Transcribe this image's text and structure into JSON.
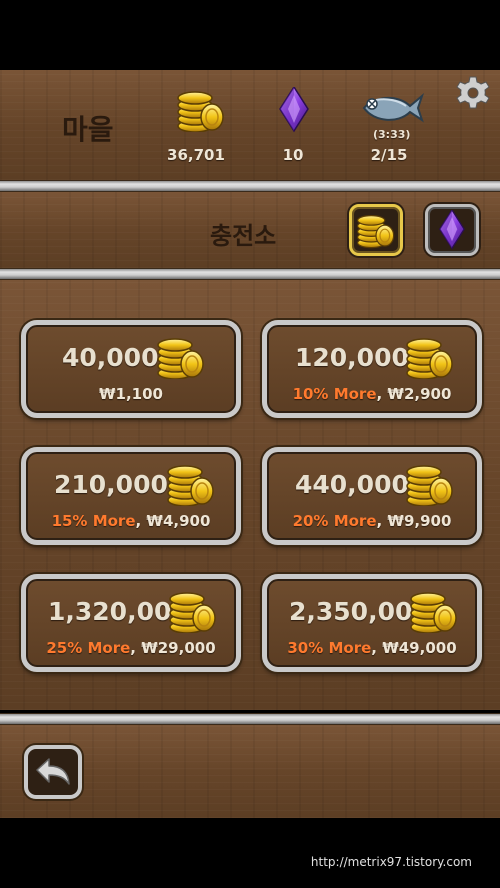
{
  "hud": {
    "village_label": "마을",
    "gold": "36,701",
    "gems": "10",
    "fish_timer": "(3:33)",
    "fish_count": "2/15",
    "settings_icon": "gear-icon"
  },
  "shop": {
    "title": "충전소",
    "tabs": [
      {
        "name": "gold-tab",
        "icon": "gold-coins-icon",
        "selected": true
      },
      {
        "name": "gem-tab",
        "icon": "purple-gem-icon",
        "selected": false
      }
    ]
  },
  "packs": [
    {
      "amount": "40,000",
      "bonus": "",
      "price": "₩1,100"
    },
    {
      "amount": "120,000",
      "bonus": "10% More",
      "price": "₩2,900"
    },
    {
      "amount": "210,000",
      "bonus": "15% More",
      "price": "₩4,900"
    },
    {
      "amount": "440,000",
      "bonus": "20% More",
      "price": "₩9,900"
    },
    {
      "amount": "1,320,000",
      "bonus": "25% More",
      "price": "₩29,000"
    },
    {
      "amount": "2,350,000",
      "bonus": "30% More",
      "price": "₩49,000"
    }
  ],
  "footer": {
    "back_icon": "back-arrow-icon"
  },
  "watermark": "http://metrix97.tistory.com",
  "colors": {
    "wood": "#6b4a2f",
    "bonus": "#ff7a2e",
    "gold": "#e7c84a",
    "gem": "#7b2fc9"
  }
}
